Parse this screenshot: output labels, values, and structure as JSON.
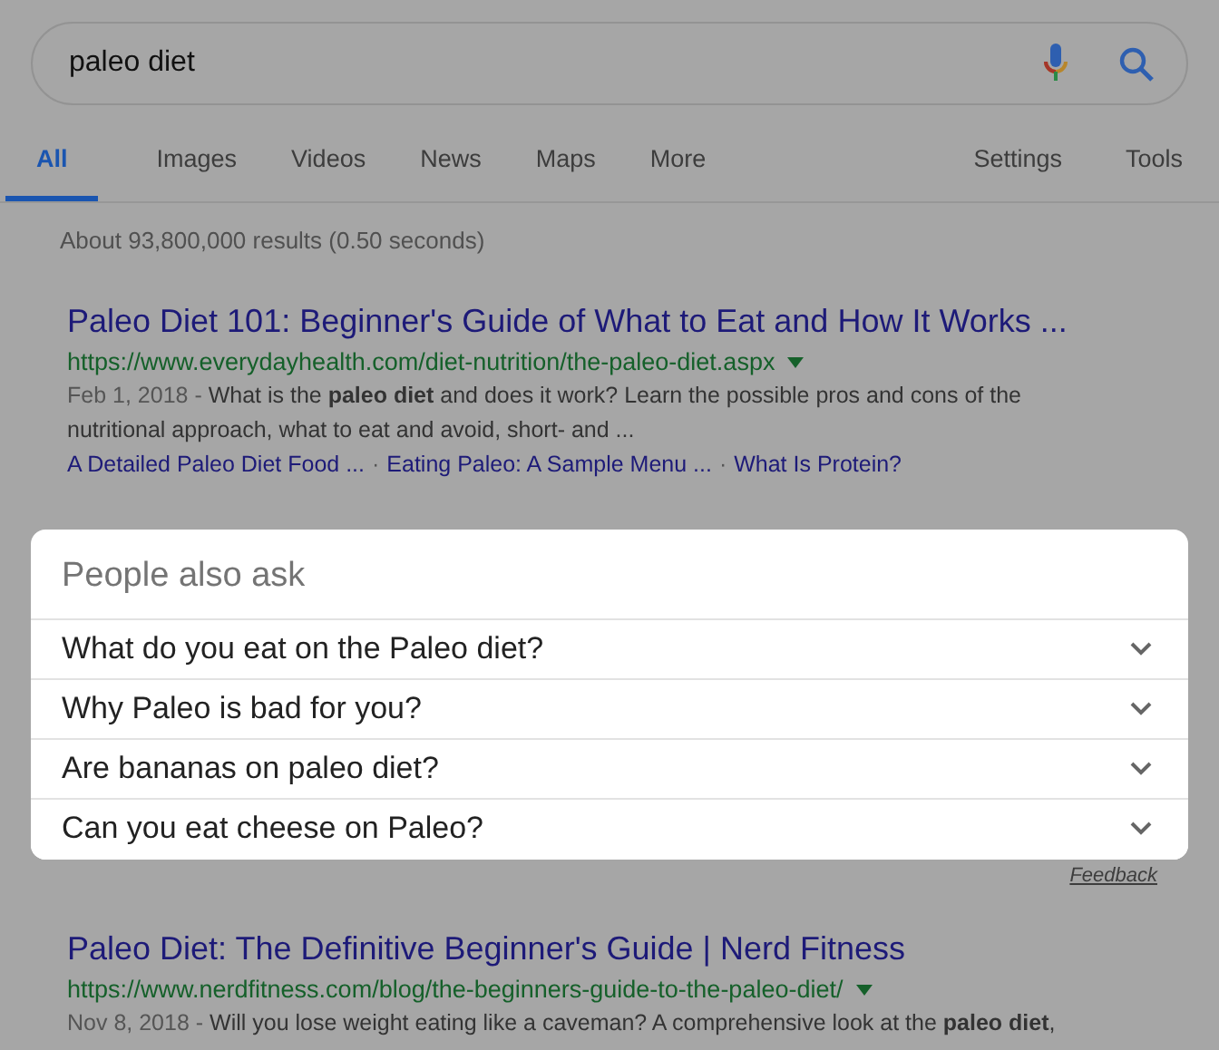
{
  "search": {
    "value": "paleo diet"
  },
  "tabs": [
    {
      "label": "All",
      "selected": true
    },
    {
      "label": "Images",
      "selected": false
    },
    {
      "label": "Videos",
      "selected": false
    },
    {
      "label": "News",
      "selected": false
    },
    {
      "label": "Maps",
      "selected": false
    },
    {
      "label": "More",
      "selected": false
    }
  ],
  "tools": [
    "Settings",
    "Tools"
  ],
  "result_stats": "About 93,800,000 results (0.50 seconds)",
  "results": [
    {
      "title": "Paleo Diet 101: Beginner's Guide of What to Eat and How It Works ...",
      "url": "https://www.everydayhealth.com/diet-nutrition/the-paleo-diet.aspx",
      "date": "Feb 1, 2018 -",
      "snippet": "What is the **paleo diet** and does it work? Learn the possible pros and cons of the nutritional approach, what to eat and avoid, short- and ...",
      "sitelinks": [
        "A Detailed Paleo Diet Food ...",
        "Eating Paleo: A Sample Menu ...",
        "What Is Protein?"
      ],
      "separators": [
        "·",
        "·"
      ]
    },
    {
      "title": "Paleo Diet: The Definitive Beginner's Guide | Nerd Fitness",
      "url": "https://www.nerdfitness.com/blog/the-beginners-guide-to-the-paleo-diet/",
      "date": "Nov 8, 2018 -",
      "snippet": "Will you lose weight eating like a caveman? A comprehensive look at the **paleo diet**,"
    }
  ],
  "people_also_ask": {
    "heading": "People also ask",
    "questions": [
      {
        "text": "What do you eat on the Paleo diet?",
        "expanded": false
      },
      {
        "text": "Why Paleo is bad for you?",
        "expanded": false
      },
      {
        "text": "Are bananas on paleo diet?",
        "expanded": false
      },
      {
        "text": "Can you eat cheese on Paleo?",
        "expanded": false
      }
    ],
    "feedback": "Feedback"
  }
}
